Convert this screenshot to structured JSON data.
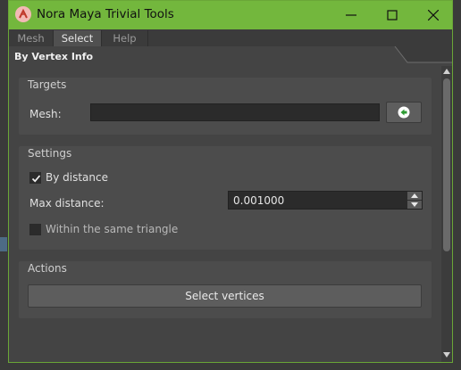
{
  "window": {
    "title": "Nora Maya Trivial Tools",
    "accent_color": "#73b73d",
    "controls": {
      "minimize_icon": "minimize-icon",
      "maximize_icon": "maximize-icon",
      "close_icon": "close-icon"
    }
  },
  "menubar": {
    "items": [
      {
        "label": "Mesh",
        "active": false
      },
      {
        "label": "Select",
        "active": true
      },
      {
        "label": "Help",
        "active": false
      }
    ]
  },
  "tab": {
    "label": "By Vertex Info"
  },
  "targets": {
    "title": "Targets",
    "mesh_label": "Mesh:",
    "mesh_value": "",
    "pick_icon": "arrow-left-icon"
  },
  "settings": {
    "title": "Settings",
    "by_distance_label": "By distance",
    "by_distance_checked": true,
    "max_distance_label": "Max distance:",
    "max_distance_value": "0.001000",
    "same_triangle_label": "Within the same triangle",
    "same_triangle_checked": false
  },
  "actions": {
    "title": "Actions",
    "select_button_label": "Select vertices"
  }
}
